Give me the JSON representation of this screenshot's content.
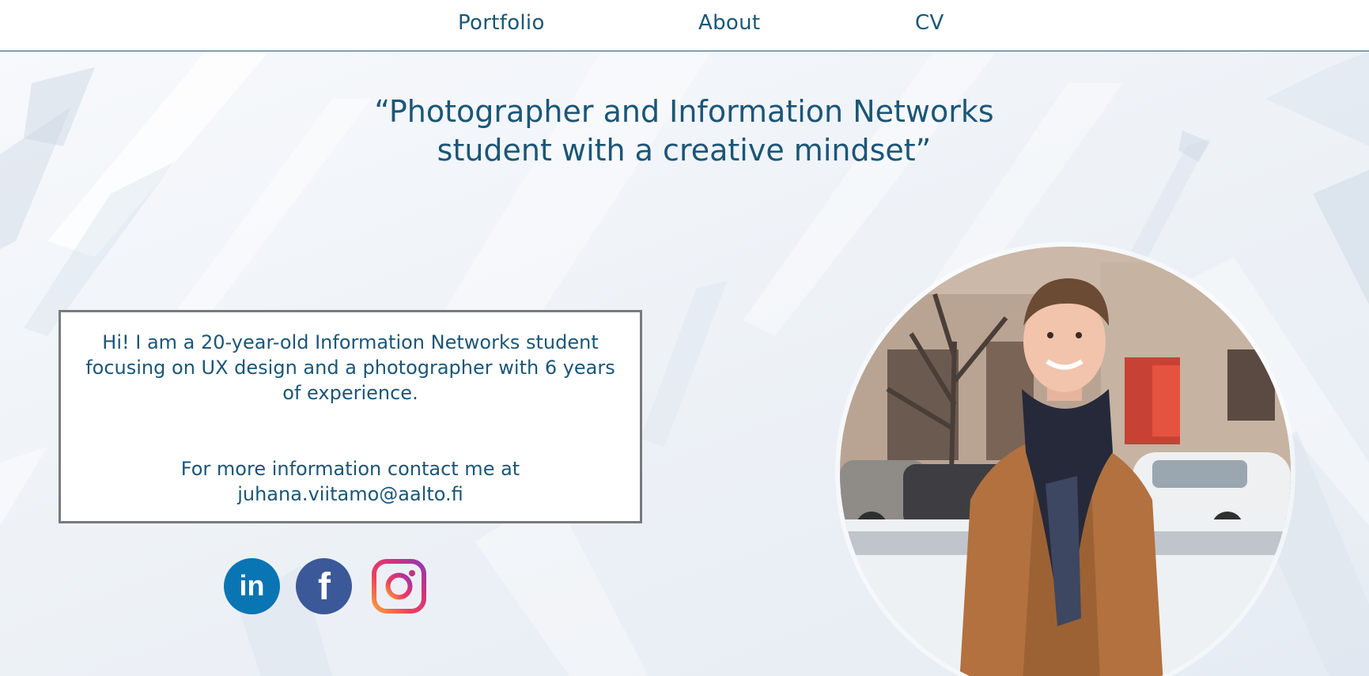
{
  "nav": {
    "items": [
      {
        "label": "Portfolio"
      },
      {
        "label": "About"
      },
      {
        "label": "CV"
      }
    ]
  },
  "hero": {
    "tagline_line1": "“Photographer and Information Networks",
    "tagline_line2": "student with a creative mindset”",
    "intro_text": "Hi! I am a 20-year-old Information Networks student focusing on UX design and a photographer with 6 years of experience.",
    "contact_prefix": "For more information contact me at",
    "contact_email": "juhana.viitamo@aalto.fi"
  },
  "social": {
    "linkedin_glyph": "in",
    "facebook_glyph": "f",
    "icons": [
      "linkedin-icon",
      "facebook-icon",
      "instagram-icon"
    ]
  },
  "colors": {
    "primary_text": "#1b5677",
    "linkedin": "#0a75b3",
    "facebook": "#3b5998",
    "box_border": "#777b80"
  }
}
